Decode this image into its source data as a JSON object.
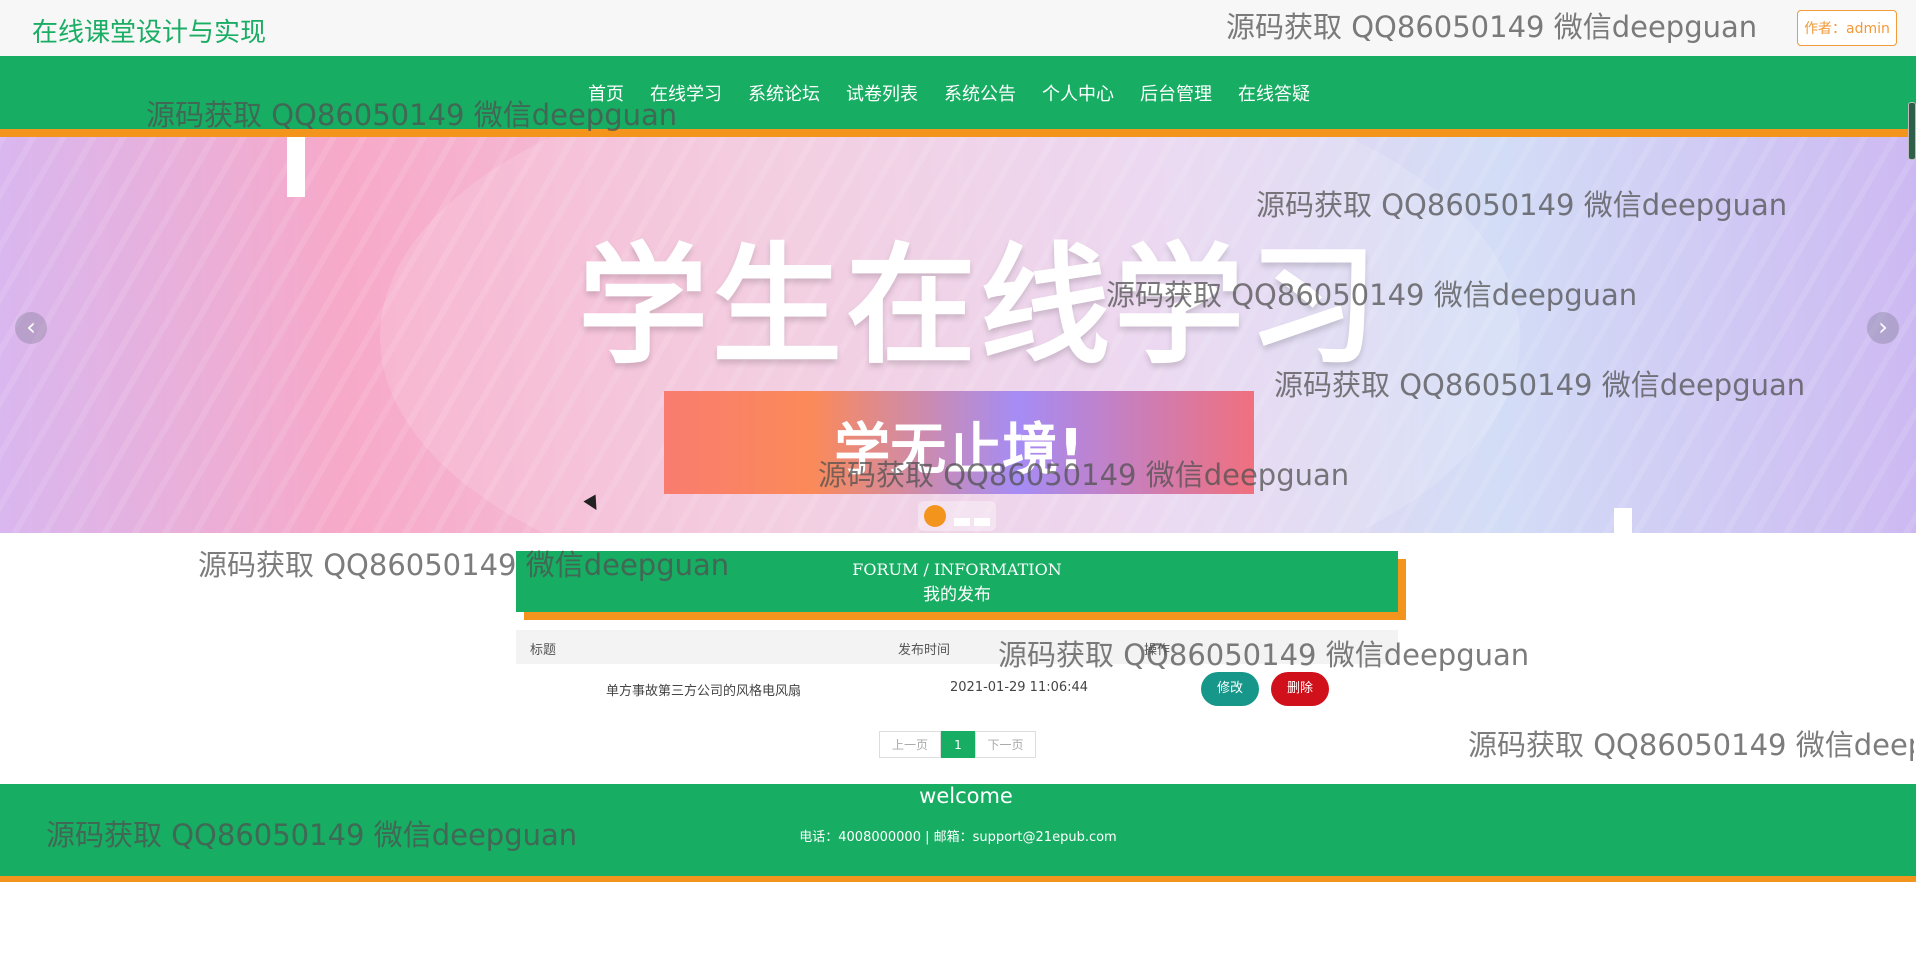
{
  "header": {
    "site_title": "在线课堂设计与实现",
    "author_badge": "作者：admin"
  },
  "nav": {
    "items": [
      "首页",
      "在线学习",
      "系统论坛",
      "试卷列表",
      "系统公告",
      "个人中心",
      "后台管理",
      "在线答疑"
    ]
  },
  "banner": {
    "headline": "学生在线学习",
    "subline": "学无止境!",
    "prev_arrow": "‹",
    "next_arrow": "›",
    "active_slide": 1,
    "slide_count": 3
  },
  "section": {
    "title_en": "FORUM / INFORMATION",
    "title_zh": "我的发布"
  },
  "table": {
    "headers": [
      "标题",
      "发布时间",
      "操作"
    ],
    "rows": [
      {
        "title": "单方事故第三方公司的风格电风扇",
        "time": "2021-01-29 11:06:44",
        "edit": "修改",
        "delete": "删除"
      }
    ]
  },
  "pager": {
    "prev": "上一页",
    "current": "1",
    "next": "下一页"
  },
  "footer": {
    "title": "welcome",
    "info": "电话：4008000000 | 邮箱：support@21epub.com"
  },
  "watermark": {
    "text": "源码获取 QQ86050149 微信deepguan"
  },
  "colors": {
    "primary_green": "#17ad63",
    "accent_orange": "#f3941d",
    "edit_teal": "#16978a",
    "delete_red": "#d0111b"
  }
}
